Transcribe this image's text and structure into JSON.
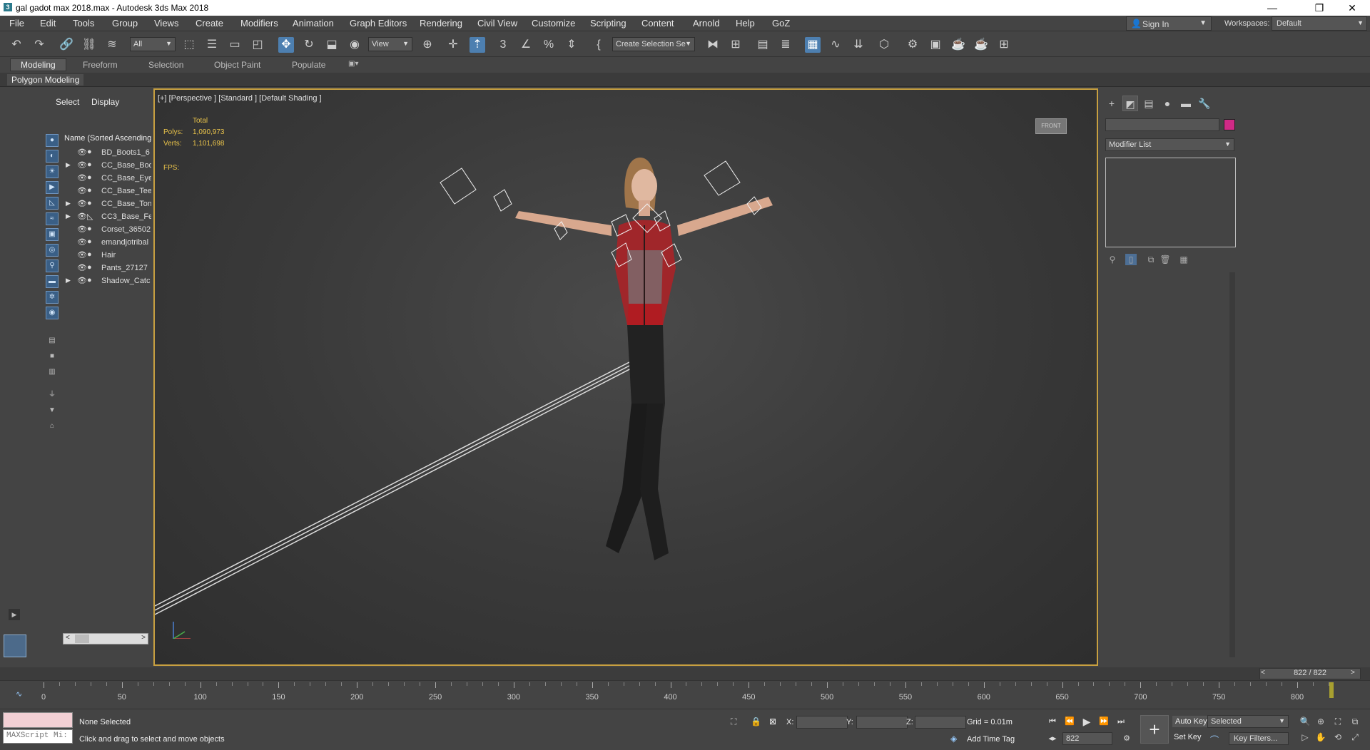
{
  "window": {
    "title": "gal gadot max 2018.max - Autodesk 3ds Max 2018",
    "minimize": "—",
    "maximize": "❐",
    "close": "✕"
  },
  "menu": [
    "File",
    "Edit",
    "Tools",
    "Group",
    "Views",
    "Create",
    "Modifiers",
    "Animation",
    "Graph Editors",
    "Rendering",
    "Civil View",
    "Customize",
    "Scripting",
    "Content",
    "Arnold",
    "Help",
    "GoZ"
  ],
  "account": {
    "sign_in": "Sign In",
    "workspaces_label": "Workspaces:",
    "workspace": "Default"
  },
  "toolbar": {
    "selection_filter": "All",
    "ref_coord": "View",
    "named_selection": "Create Selection Se"
  },
  "ribbon": {
    "tabs": [
      "Modeling",
      "Freeform",
      "Selection",
      "Object Paint",
      "Populate"
    ],
    "active_tab": "Modeling",
    "panel_label": "Polygon Modeling"
  },
  "explorer": {
    "tabs": [
      "Select",
      "Display"
    ],
    "column_header": "Name (Sorted Ascending",
    "items": [
      {
        "name": "BD_Boots1_6",
        "expandable": false
      },
      {
        "name": "CC_Base_Bod",
        "expandable": true
      },
      {
        "name": "CC_Base_Eye",
        "expandable": false
      },
      {
        "name": "CC_Base_Tee",
        "expandable": false
      },
      {
        "name": "CC_Base_Ton",
        "expandable": true
      },
      {
        "name": "CC3_Base_Fe",
        "expandable": true
      },
      {
        "name": "Corset_36502",
        "expandable": false
      },
      {
        "name": "emandjotribal",
        "expandable": false
      },
      {
        "name": "Hair",
        "expandable": false
      },
      {
        "name": "Pants_27127",
        "expandable": false
      },
      {
        "name": "Shadow_Catc",
        "expandable": true
      }
    ]
  },
  "viewport": {
    "label": "[+] [Perspective ] [Standard ] [Default Shading ]",
    "stats_total": "Total",
    "polys_label": "Polys:",
    "polys_value": "1,090,973",
    "verts_label": "Verts:",
    "verts_value": "1,101,698",
    "fps_label": "FPS:",
    "viewcube": "FRONT"
  },
  "command_panel": {
    "modifier_list": "Modifier List",
    "object_color": "#d02a86"
  },
  "timeline": {
    "frame_display": "822 / 822",
    "ticks": [
      0,
      50,
      100,
      150,
      200,
      250,
      300,
      350,
      400,
      450,
      500,
      550,
      600,
      650,
      700,
      750,
      800
    ],
    "current_frame": 822,
    "total_frames": 822
  },
  "status": {
    "maxscript_placeholder": "MAXScript Mi:",
    "selection": "None Selected",
    "prompt": "Click and drag to select and move objects",
    "x_label": "X:",
    "y_label": "Y:",
    "z_label": "Z:",
    "grid": "Grid = 0.01m",
    "add_time_tag": "Add Time Tag",
    "frame_spinner": "822",
    "auto_key": "Auto Key",
    "set_key": "Set Key",
    "key_mode": "Selected",
    "key_filters": "Key Filters..."
  },
  "colors": {
    "viewport_border": "#c8a040",
    "stats_text": "#e8c24a",
    "active_tool": "#4d7fb0"
  }
}
